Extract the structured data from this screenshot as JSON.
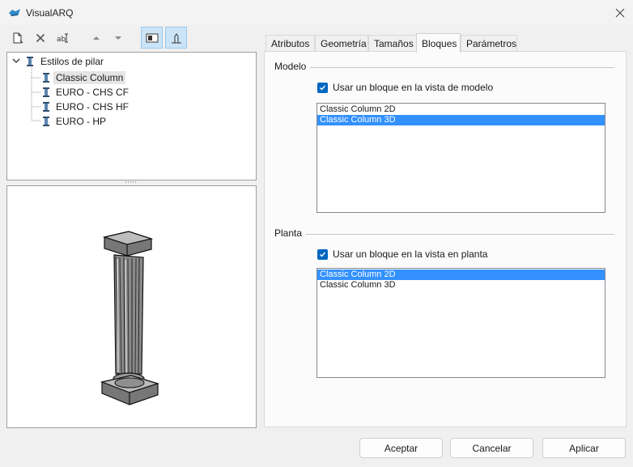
{
  "window": {
    "title": "VisualARQ"
  },
  "toolbar": {
    "buttons": [
      {
        "icon": "new-document-icon"
      },
      {
        "icon": "delete-icon"
      },
      {
        "icon": "rename-icon"
      },
      {
        "icon": "move-up-icon"
      },
      {
        "icon": "move-down-icon"
      },
      {
        "icon": "style-view-icon",
        "active": true
      },
      {
        "icon": "profile-view-icon",
        "active": true
      }
    ]
  },
  "tree": {
    "root": "Estilos de pilar",
    "items": [
      "Classic Column",
      "EURO - CHS CF",
      "EURO - CHS HF",
      "EURO - HP"
    ],
    "selected": "Classic Column"
  },
  "tabs": [
    "Atributos",
    "Geometría",
    "Tamaños",
    "Bloques",
    "Parámetros"
  ],
  "active_tab": "Bloques",
  "modelo": {
    "title": "Modelo",
    "checkbox_label": "Usar un bloque en la vista de modelo",
    "checked": true,
    "items": [
      "Classic Column 2D",
      "Classic Column 3D"
    ],
    "selected": "Classic Column 3D"
  },
  "planta": {
    "title": "Planta",
    "checkbox_label": "Usar un bloque en la vista en planta",
    "checked": true,
    "items": [
      "Classic Column 2D",
      "Classic Column 3D"
    ],
    "selected": "Classic Column 2D"
  },
  "buttons": {
    "accept": "Aceptar",
    "cancel": "Cancelar",
    "apply": "Aplicar"
  },
  "colors": {
    "accent": "#0067c0",
    "selection": "#3391ff"
  }
}
